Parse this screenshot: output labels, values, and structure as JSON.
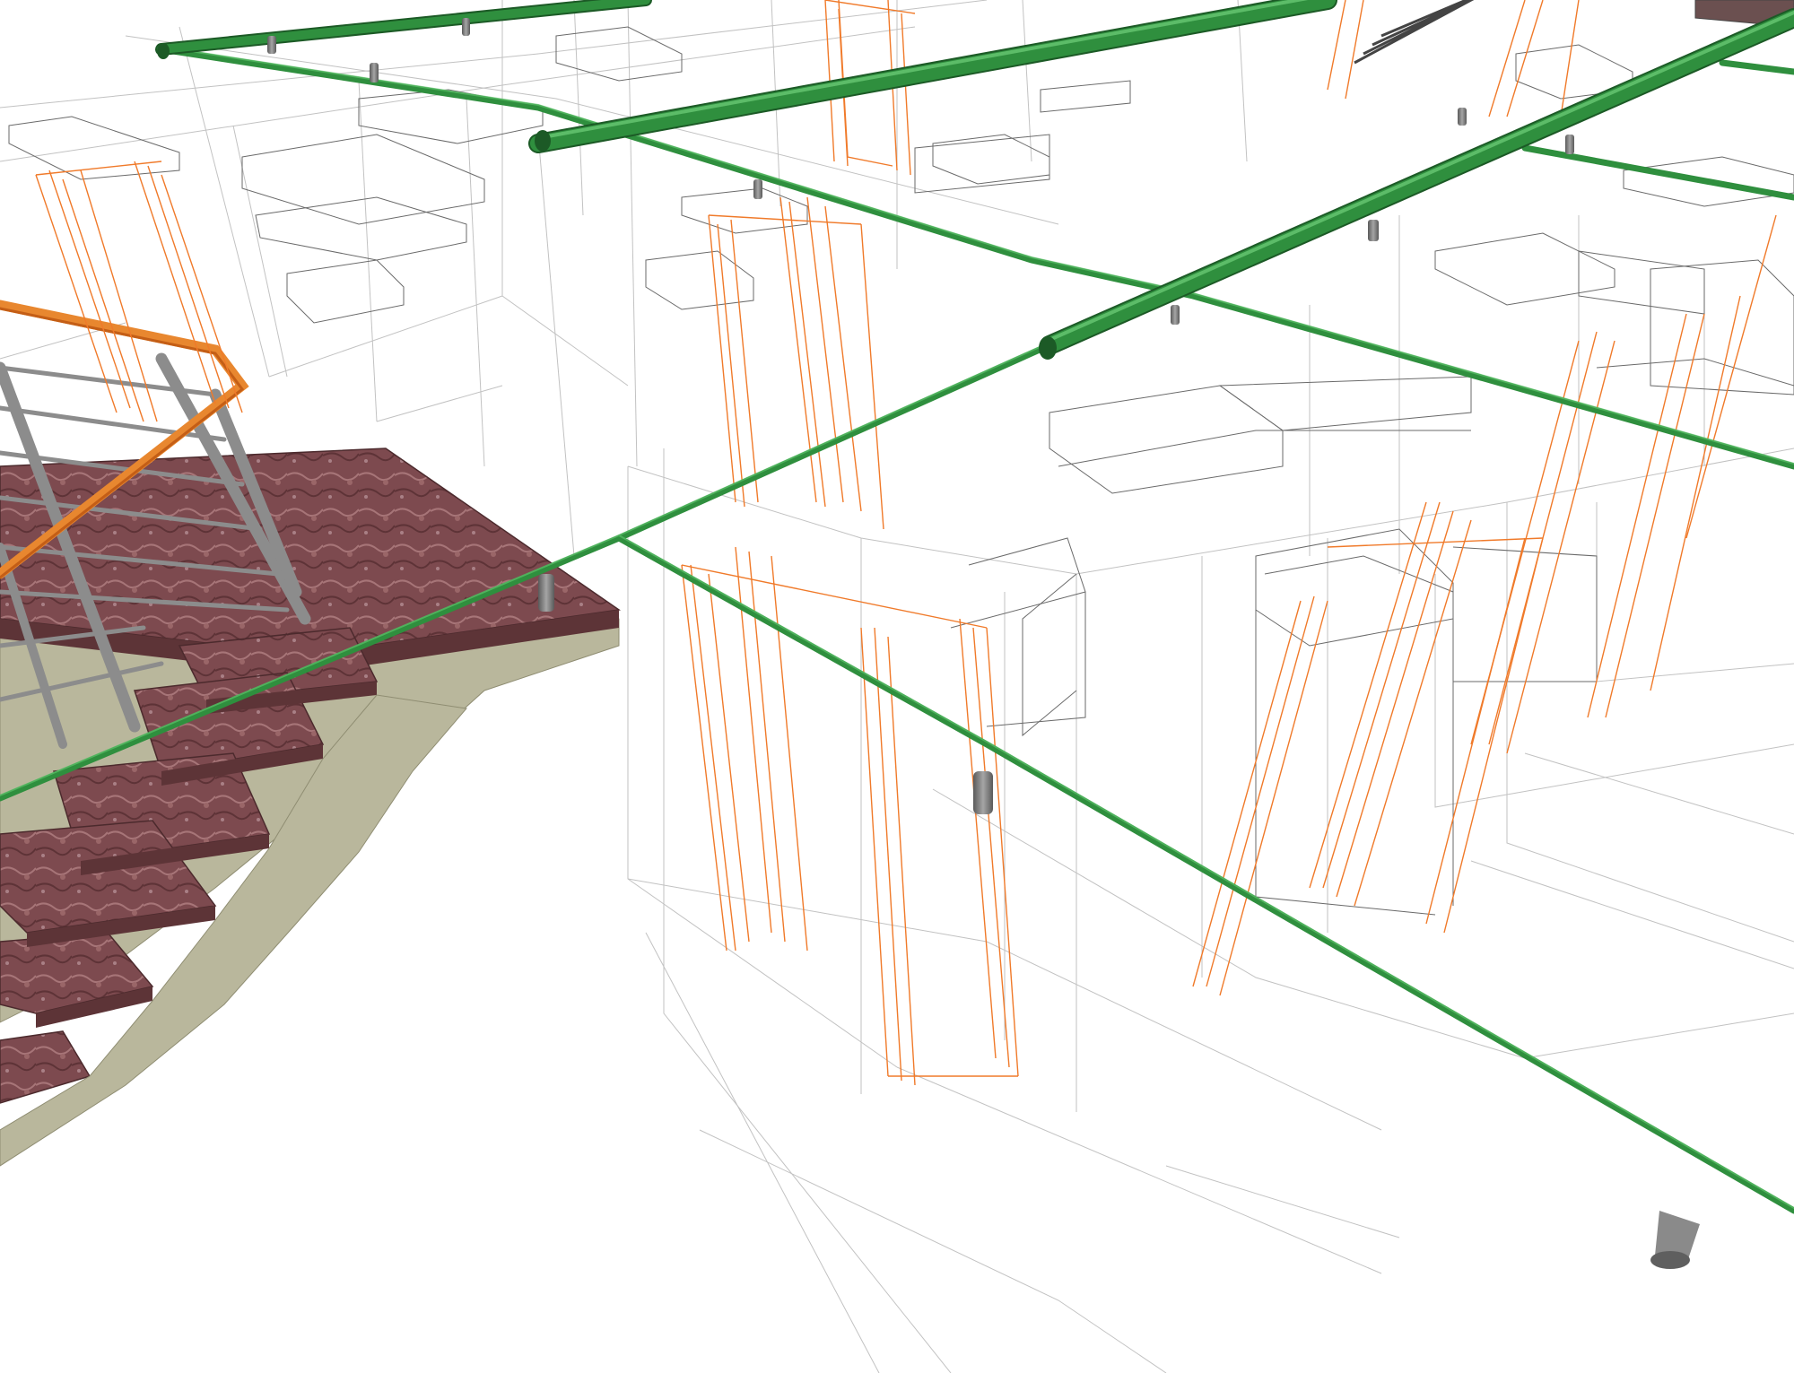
{
  "scene": {
    "kind": "BIM 3D wireframe render",
    "elements": [
      "wall-wireframe",
      "door-frame",
      "window-frame",
      "staircase",
      "stair-handrail",
      "sprinkler-pipe",
      "sprinkler-drop"
    ],
    "colors": {
      "background": "#ffffff",
      "wireframe": "#b4b4b4",
      "wireframe_dark": "#5a5a5a",
      "door": "#f07a2a",
      "pipe": "#2f8f3e",
      "pipe_highlight": "#5cc06a",
      "pipe_shadow": "#1c5a26",
      "stair_tread": "#7d4a4f",
      "stair_concrete": "#b9b79c",
      "railing": "#8c8c8c",
      "handrail": "#e8872f",
      "drop": "#8a8a8a"
    }
  }
}
